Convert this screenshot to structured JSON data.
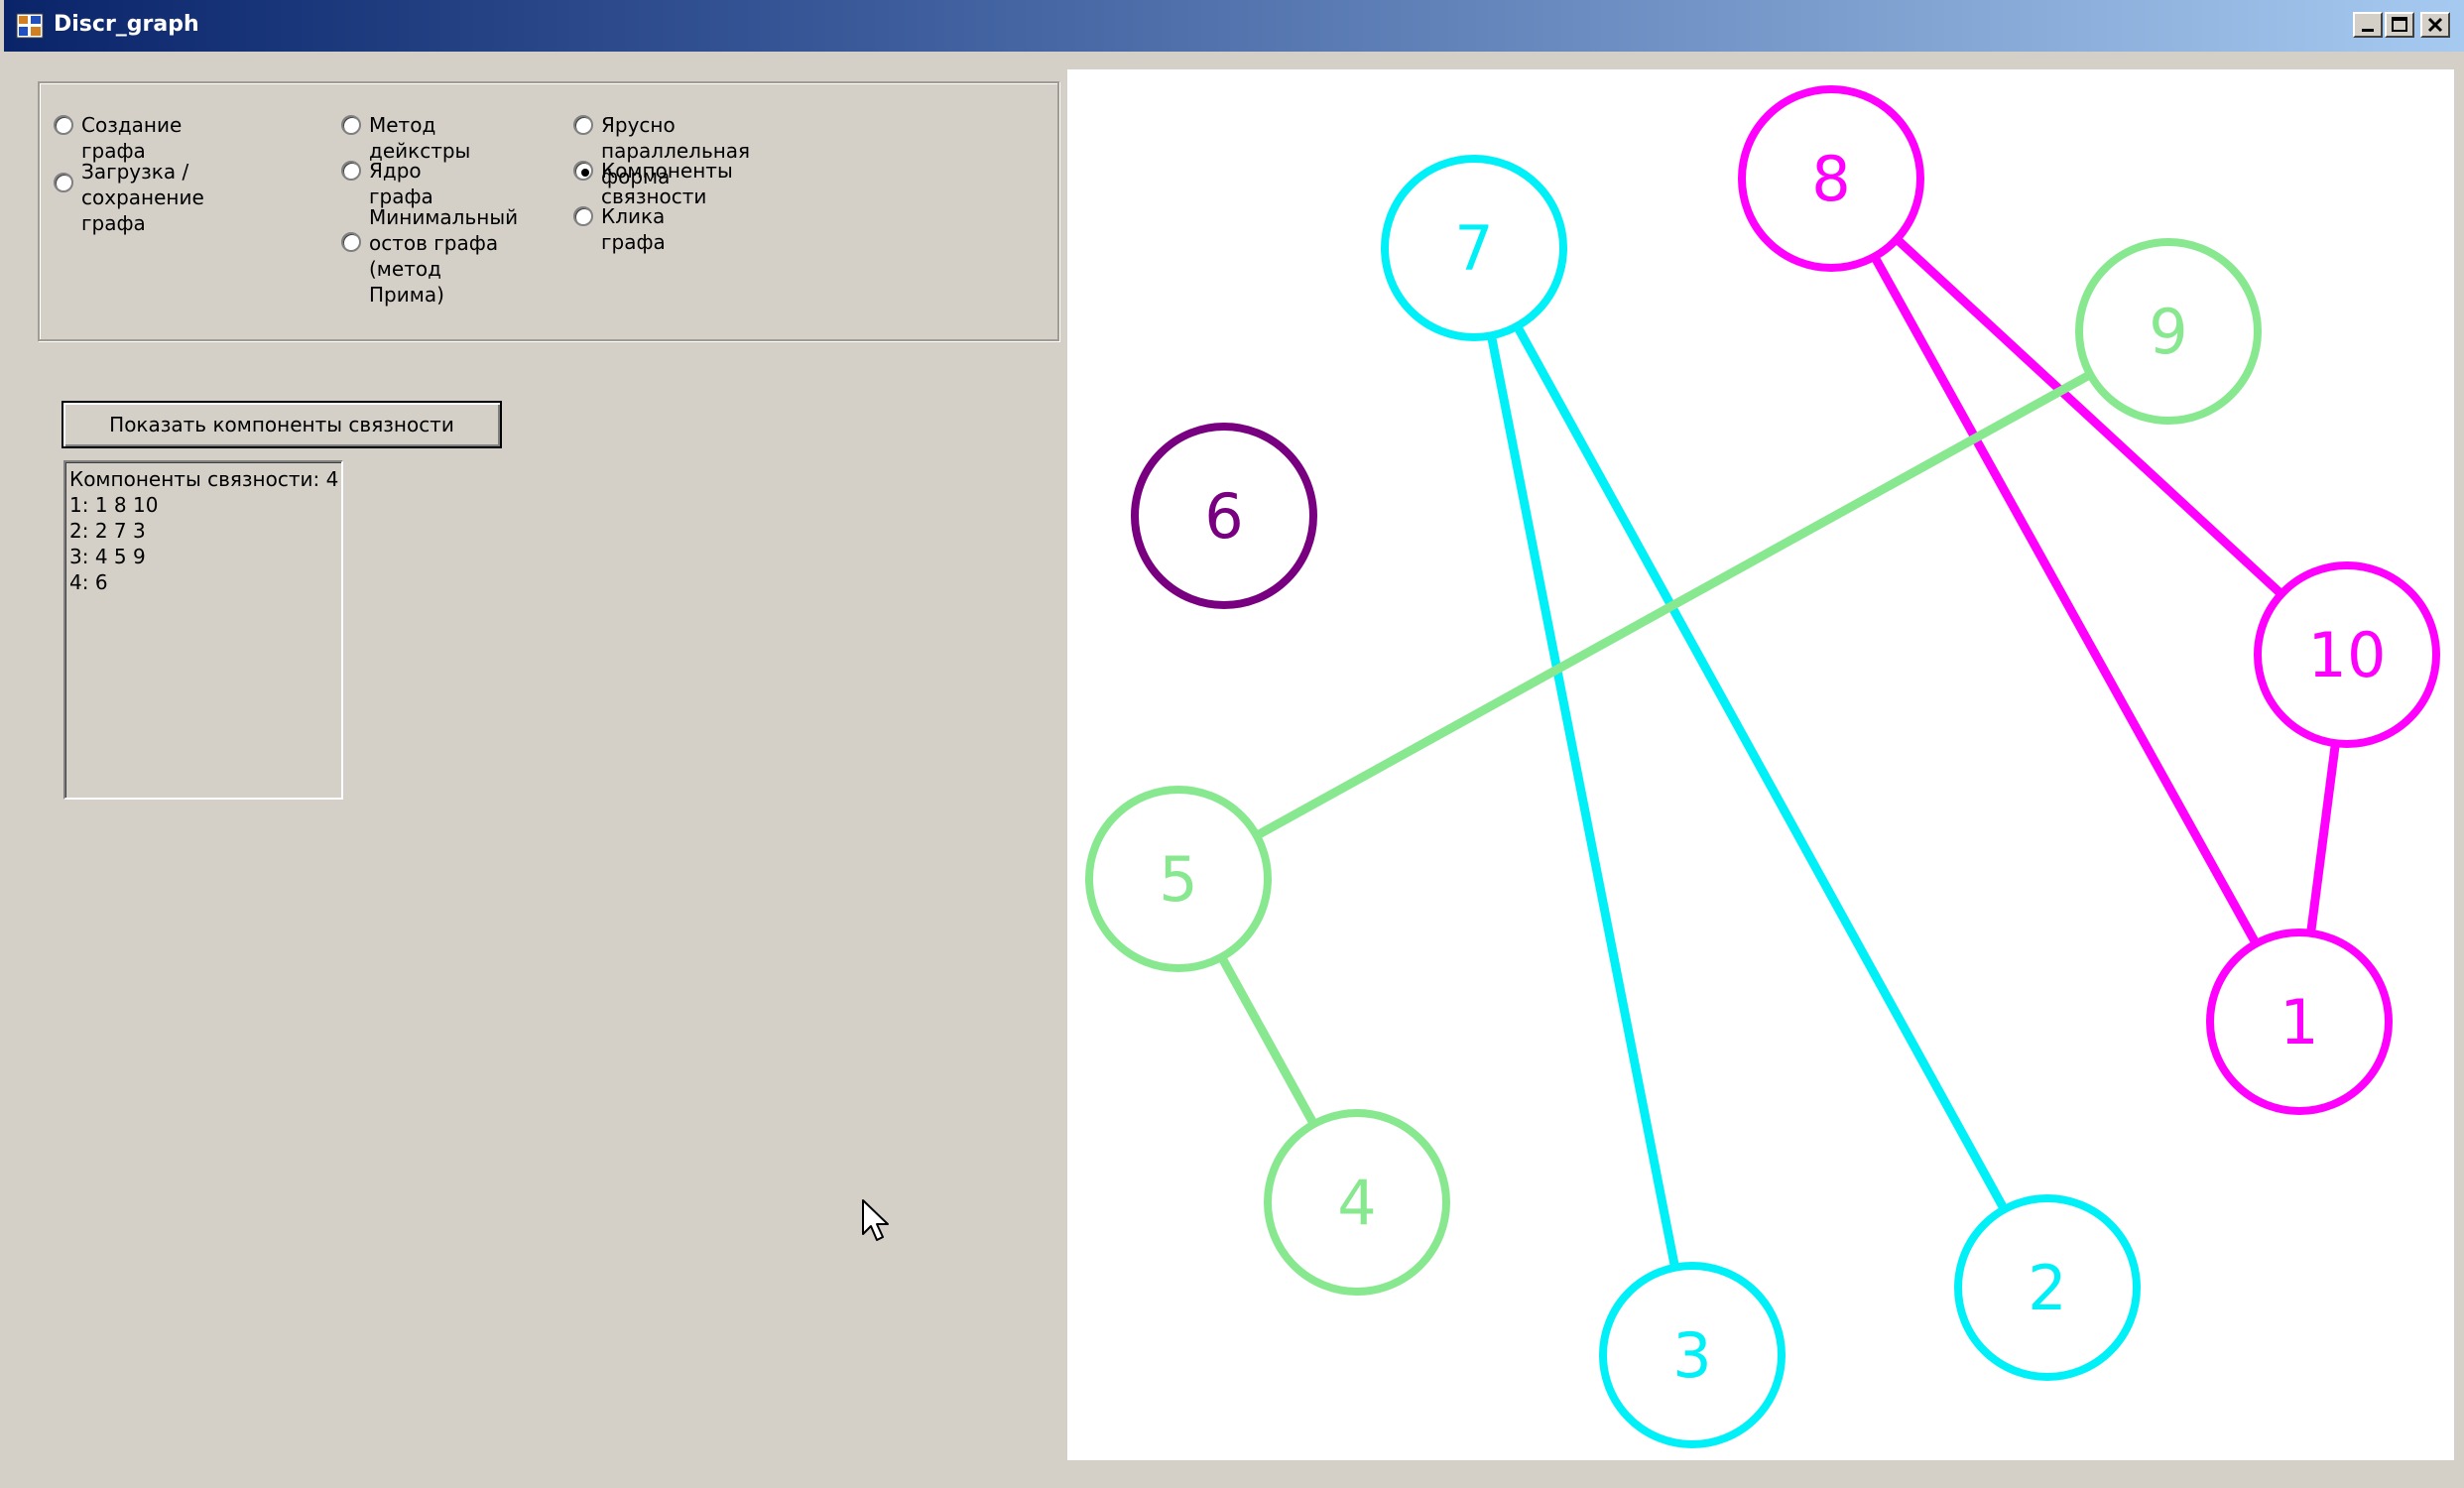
{
  "window": {
    "title": "Discr_graph"
  },
  "options": [
    {
      "label": "Создание графа",
      "selected": false
    },
    {
      "label": "Загрузка / сохранение\nграфа",
      "selected": false
    },
    {
      "label": "Метод дейкстры",
      "selected": false
    },
    {
      "label": "Ядро графа",
      "selected": false
    },
    {
      "label": "Минимальный\nостов графа\n(метод Прима)",
      "selected": false
    },
    {
      "label": "Ярусно параллельная форма",
      "selected": false
    },
    {
      "label": "Компоненты связности",
      "selected": true
    },
    {
      "label": "Клика графа",
      "selected": false
    }
  ],
  "action_button": {
    "label": "Показать компоненты связности"
  },
  "result": {
    "lines": [
      "Компоненты связности: 4",
      "1: 1 8 10",
      "2: 2 7 3",
      "3: 4 5 9",
      "4: 6"
    ]
  },
  "graph": {
    "component_colors": {
      "component_1": "#ff00ff",
      "component_2": "#00f0f8",
      "component_3": "#88e890",
      "component_4": "#780080"
    },
    "nodes": [
      {
        "id": "1",
        "component": "component_1"
      },
      {
        "id": "2",
        "component": "component_2"
      },
      {
        "id": "3",
        "component": "component_2"
      },
      {
        "id": "4",
        "component": "component_3"
      },
      {
        "id": "5",
        "component": "component_3"
      },
      {
        "id": "6",
        "component": "component_4"
      },
      {
        "id": "7",
        "component": "component_2"
      },
      {
        "id": "8",
        "component": "component_1"
      },
      {
        "id": "9",
        "component": "component_3"
      },
      {
        "id": "10",
        "component": "component_1"
      }
    ],
    "edges": [
      {
        "from": "8",
        "to": "10",
        "component": "component_1"
      },
      {
        "from": "8",
        "to": "1",
        "component": "component_1"
      },
      {
        "from": "10",
        "to": "1",
        "component": "component_1"
      },
      {
        "from": "7",
        "to": "3",
        "component": "component_2"
      },
      {
        "from": "7",
        "to": "2",
        "component": "component_2"
      },
      {
        "from": "9",
        "to": "5",
        "component": "component_3"
      },
      {
        "from": "5",
        "to": "4",
        "component": "component_3"
      }
    ]
  }
}
